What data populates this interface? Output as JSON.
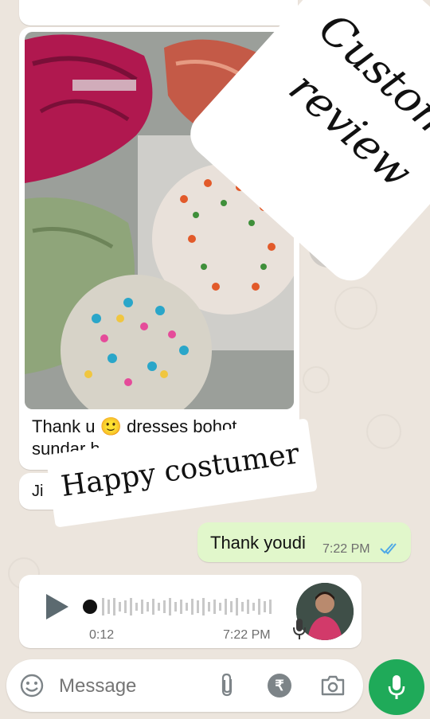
{
  "chat": {
    "photo_caption_line1": "Thank u 🙂 dresses bohot",
    "photo_caption_line2": "sundar h",
    "small_reply": "Ji",
    "sent_message": "Thank youdi",
    "sent_time": "7:22 PM",
    "voice": {
      "duration": "0:12",
      "time": "7:22 PM"
    }
  },
  "overlay": {
    "custom_review_line1": "Custom",
    "custom_review_line2": "review",
    "happy_customer": "Happy costumer"
  },
  "composer": {
    "placeholder": "Message",
    "rupee_symbol": "₹"
  },
  "colors": {
    "outgoing_bubble": "#e1f7cb",
    "read_ticks": "#4fa9e6",
    "mic_button": "#1faa59"
  },
  "icons": [
    "forward-icon",
    "read-ticks-icon",
    "play-icon",
    "mic-icon",
    "emoji-icon",
    "attach-icon",
    "rupee-icon",
    "camera-icon"
  ]
}
